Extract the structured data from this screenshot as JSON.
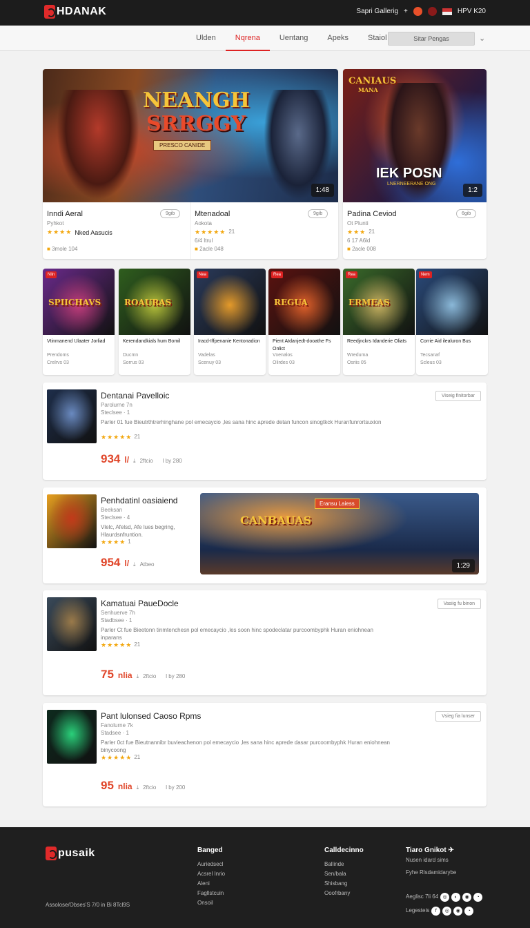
{
  "header": {
    "brand": "HDANAK",
    "links": "Sapri Gallerig",
    "plus": "+",
    "flag_text": "HPV K20"
  },
  "nav": {
    "items": [
      "Ulden",
      "Nqrena",
      "Uentang",
      "Apeks",
      "Staiol"
    ],
    "active_index": 1,
    "search_placeholder": "Sitar Pengas"
  },
  "hero": {
    "main": {
      "art_title_1": "NEANGH",
      "art_title_2": "SRRGGY",
      "art_banner": "PRESCO CANIDE",
      "badge": "1:48",
      "title": "Inndi Aeral",
      "sub": "Pyhkot",
      "stars": "★★★★",
      "rating_label": "Nked Aasucis",
      "tag": "3mole 104",
      "pill": "9gib"
    },
    "second": {
      "title": "Mtenadoal",
      "sub": "Aokota",
      "stars": "★★★★★",
      "rating_text": "21",
      "line2": "6/4 ltrul",
      "tag": "2acle 048",
      "pill": "9gib"
    },
    "side": {
      "art_title": "CANIAUS",
      "art_sub": "MANA",
      "art_big": "IEK POSN",
      "art_small": "LNERNEERANE ONG",
      "badge": "1:2",
      "title": "Padina Ceviod",
      "sub": "Ot Plunti",
      "stars": "★★★",
      "rating_text": "21",
      "line2": "6 17 A6ld",
      "tag": "2acle 008",
      "pill": "6gib"
    }
  },
  "thumbs": [
    {
      "tag": "Nlin",
      "art": "SPIICHAVS",
      "title": "Vtinmanend Ulaater Jorliad",
      "sub": "Prendoms",
      "sub2": "Crelrvs 03",
      "colors": [
        "#6a2a8a",
        "#c23d7a"
      ]
    },
    {
      "tag": "",
      "art": "ROAURAS",
      "title": "Kerendandkials hum Bomil",
      "sub": "Ducmn",
      "sub2": "Sorrus 03",
      "colors": [
        "#2f5e1e",
        "#b6c03a"
      ]
    },
    {
      "tag": "Nea",
      "art": "",
      "title": "Iracd-Iffpenanie Kentonadion",
      "sub": "Vadelas",
      "sub2": "Scenuy 03",
      "colors": [
        "#2a3a5a",
        "#e49a2a"
      ]
    },
    {
      "tag": "Rea",
      "art": "REGUA",
      "title": "Pient Atdanjedt-dooathe Fs Onlict",
      "sub": "Vxenalos",
      "sub2": "Olirdes 03",
      "colors": [
        "#5a1210",
        "#e0612a"
      ]
    },
    {
      "tag": "Rea",
      "art": "ERMEAS",
      "title": "Reedjnckrs Idanderie Oliats",
      "sub": "Wreduma",
      "sub2": "Osriis 05",
      "colors": [
        "#3a6a2a",
        "#c8b060"
      ]
    },
    {
      "tag": "Nem",
      "art": "",
      "title": "Corrie Aid ilealuron Bus",
      "sub": "Tecsanaf",
      "sub2": "Scleus 03",
      "colors": [
        "#2a4a7a",
        "#8ab8d8"
      ]
    }
  ],
  "list": [
    {
      "title": "Dentanai Pavelloic",
      "sub": "Parolurne 7n",
      "sub2": "Steclsee · 1",
      "desc": "Parler 01 fue Bieutrthtrerhinghane pol emecaycio ,les sana hinc aprede detan funcon sinogtkck Huranfunrortsuxion",
      "stars": "★★★★★",
      "rating_text": "21",
      "price": "934",
      "price_suffix": "l/",
      "meta1": "2ftcio",
      "meta2": "l by 280",
      "btn": "Viseig finitorbar",
      "colors": [
        "#1e2e4a",
        "#6a8ac0"
      ]
    },
    {
      "title": "Penhdatinl oasiaiend",
      "sub": "Beeksan",
      "sub2": "Steclsee · 4",
      "desc": "Vlelc, Afelsd, Afe lues begring, Hlaurdsnfruntion.",
      "stars": "★★★★",
      "rating_text": "1",
      "price": "954",
      "price_suffix": "l/",
      "meta1": "Atbeo",
      "meta2": "",
      "btn": "",
      "banner_tag": "Eransu Laiess",
      "banner_art": "CANBAUAS",
      "banner_badge": "1:29",
      "colors": [
        "#e8a020",
        "#c23a1a"
      ]
    },
    {
      "title": "Kamatuai PaueDocle",
      "sub": "Senhuerve 7h",
      "sub2": "Stadbsee · 1",
      "desc": "Parler Ct fue Bieetonn tinmtenchesn pol emecaycio ,les soon hinc spodeclatar purcoombyphk Huran eniohnean inparans",
      "stars": "★★★★★",
      "rating_text": "21",
      "price": "75",
      "price_suffix": "nlia",
      "meta1": "2ftcio",
      "meta2": "l by 280",
      "btn": "Vasiig fu binon",
      "colors": [
        "#3a4a5a",
        "#9a7a4a"
      ]
    },
    {
      "title": "Pant lulonsed Caoso Rpms",
      "sub": "Fanolurne 7k",
      "sub2": "Stadsee · 1",
      "desc": "Parler 0ct fue Bieutnannibr buvieachenon pol emecaycio ,les sana hinc aprede dasar purcoombyphk Huran eniohnean binycoong",
      "stars": "★★★★★",
      "rating_text": "21",
      "price": "95",
      "price_suffix": "nlia",
      "meta1": "2ftcio",
      "meta2": "l by 200",
      "btn": "Vsieg fia lunser",
      "colors": [
        "#0e2a1e",
        "#2ad07a"
      ]
    }
  ],
  "footer": {
    "brand": "pusaik",
    "copyright": "Assolose/Obses'S 7/0 in Bi 8Tcl9S",
    "col1": {
      "head": "Banged",
      "links": [
        "Auriedsecl",
        "Acsrel Inrio",
        "Aleni",
        "Fagllstcuin",
        "Onsoil"
      ]
    },
    "col2": {
      "head": "Calldecinno",
      "links": [
        "Ballinde",
        "Sen/bala",
        "Shisbang",
        "Ooofrbany"
      ]
    },
    "col3": {
      "head": "Tiaro Gnikot",
      "line1": "Nusen idard sims",
      "line2": "Fyhe Rlsdamidarybe",
      "row1": "Aeglisc 7li 64",
      "row2": "Legesteis"
    }
  }
}
